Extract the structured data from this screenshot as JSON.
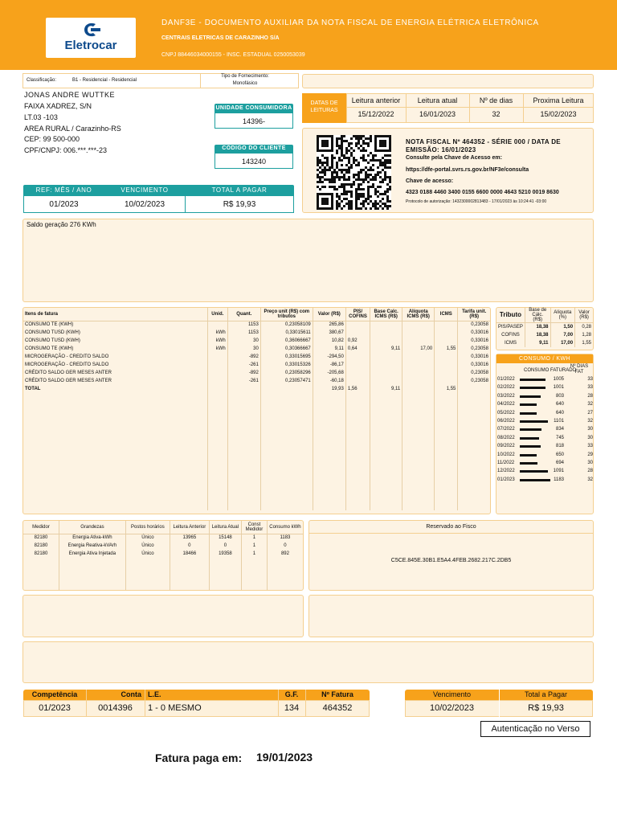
{
  "header": {
    "logo_text": "Eletrocar",
    "title": "DANF3E - DOCUMENTO AUXILIAR DA NOTA FISCAL DE ENERGIA ELÉTRICA ELETRÔNICA",
    "company": "CENTRAIS ELETRICAS DE CARAZINHO S/A",
    "cnpj": "CNPJ 88446034000155 - INSC. ESTADUAL 0250053039"
  },
  "classification": {
    "label": "Classificação:",
    "value": "B1 - Residencial - Residencial",
    "supply_label": "Tipo de Fornecimento:",
    "supply_value": "Monofásico"
  },
  "customer": {
    "name": "JONAS ANDRE WUTTKE",
    "address1": "FAIXA XADREZ, S/N",
    "address2": "LT.03 -103",
    "address3": "AREA RURAL / Carazinho-RS",
    "cep": "CEP: 99 500-000",
    "cpf": "CPF/CNPJ: 006.***.***-23"
  },
  "unit": {
    "label": "UNIDADE CONSUMIDORA",
    "value": "14396-"
  },
  "client_code": {
    "label": "CÓDIGO DO CLIENTE",
    "value": "143240"
  },
  "ref_box": {
    "ref_label": "REF: MÊS / ANO",
    "ref_value": "01/2023",
    "due_label": "VENCIMENTO",
    "due_value": "10/02/2023",
    "total_label": "TOTAL A PAGAR",
    "total_value": "R$ 19,93"
  },
  "readings": {
    "label_line1": "DATAS DE",
    "label_line2": "LEITURAS",
    "columns": [
      {
        "label": "Leitura anterior",
        "value": "15/12/2022"
      },
      {
        "label": "Leitura atual",
        "value": "16/01/2023"
      },
      {
        "label": "Nº de dias",
        "value": "32"
      },
      {
        "label": "Proxima Leitura",
        "value": "15/02/2023"
      }
    ]
  },
  "nf": {
    "line1": "NOTA FISCAL Nº 464352 - SÉRIE 000 / DATA DE",
    "line2": "EMISSÃO: 16/01/2023",
    "line3": "Consulte pela Chave de Acesso em:",
    "url": "https://dfe-portal.svrs.rs.gov.br/NF3e/consulta",
    "key_label": "Chave de acesso:",
    "key": "4323 0188 4460 3400 0155 6600 0000 4643 5210 0019 8630",
    "protocol": "Protocolo de autorização: 1432300002813483 - 17/01/2023 às 10:24:41 -03:00"
  },
  "messages": {
    "text": "Saldo geração 276 KWh"
  },
  "items": {
    "headers": [
      "Itens de fatura",
      "Unid.",
      "Quant.",
      "Preço unit (R$) com tributos",
      "Valor (R$)",
      "PIS/ COFINS",
      "Base Calc. ICMS (R$)",
      "Alíquota ICMS (R$)",
      "ICMS",
      "Tarifa unit. (R$)"
    ],
    "rows": [
      [
        "CONSUMO TE (KWH)",
        "",
        "1153",
        "0,23058109",
        "265,86",
        "",
        "",
        "",
        "",
        "0,23058"
      ],
      [
        "CONSUMO TUSD (KWH)",
        "kWh",
        "1153",
        "0,33015611",
        "380,67",
        "",
        "",
        "",
        "",
        "0,33016"
      ],
      [
        "CONSUMO TUSD (KWH)",
        "kWh",
        "30",
        "0,36066667",
        "10,82",
        "0,92",
        "",
        "",
        "",
        "0,33016"
      ],
      [
        "CONSUMO TE (KWH)",
        "kWh",
        "30",
        "0,30366667",
        "9,11",
        "0,64",
        "9,11",
        "17,00",
        "1,55",
        "0,23058"
      ],
      [
        "MICROGERAÇÃO - CREDITO SALDO",
        "",
        "-892",
        "0,33015695",
        "-294,50",
        "",
        "",
        "",
        "",
        "0,33016"
      ],
      [
        "MICROGERAÇÃO - CREDITO SALDO",
        "",
        "-261",
        "0,33015326",
        "-86,17",
        "",
        "",
        "",
        "",
        "0,33016"
      ],
      [
        "CRÉDITO SALDO GER MESES ANTER",
        "",
        "-892",
        "0,23058296",
        "-205,68",
        "",
        "",
        "",
        "",
        "0,23058"
      ],
      [
        "CRÉDITO SALDO GER MESES ANTER",
        "",
        "-261",
        "0,23057471",
        "-60,18",
        "",
        "",
        "",
        "",
        "0,23058"
      ]
    ],
    "total": [
      "TOTAL",
      "",
      "",
      "",
      "19,93",
      "1,56",
      "9,11",
      "",
      "1,55",
      ""
    ]
  },
  "taxes": {
    "headers": [
      "Tributo",
      "Base de Cálc. (R$)",
      "Alíquota (%)",
      "Valor (R$)"
    ],
    "rows": [
      [
        "PIS/PASEP",
        "18,38",
        "1,50",
        "0,28"
      ],
      [
        "COFINS",
        "18,38",
        "7,00",
        "1,28"
      ],
      [
        "ICMS",
        "9,11",
        "17,00",
        "1,55"
      ]
    ]
  },
  "consumption": {
    "title": "CONSUMO / KWH",
    "col1": "CONSUMO FATURADO",
    "col2": "Nº DIAS FAT",
    "max": 1183,
    "rows": [
      {
        "month": "01/2022",
        "kwh": 1005,
        "days": "33"
      },
      {
        "month": "02/2022",
        "kwh": 1001,
        "days": "33"
      },
      {
        "month": "03/2022",
        "kwh": 803,
        "days": "28"
      },
      {
        "month": "04/2022",
        "kwh": 640,
        "days": "32"
      },
      {
        "month": "05/2022",
        "kwh": 640,
        "days": "27"
      },
      {
        "month": "06/2022",
        "kwh": 1101,
        "days": "32"
      },
      {
        "month": "07/2022",
        "kwh": 834,
        "days": "30"
      },
      {
        "month": "08/2022",
        "kwh": 745,
        "days": "30"
      },
      {
        "month": "09/2022",
        "kwh": 818,
        "days": "33"
      },
      {
        "month": "10/2022",
        "kwh": 650,
        "days": "29"
      },
      {
        "month": "11/2022",
        "kwh": 694,
        "days": "30"
      },
      {
        "month": "12/2022",
        "kwh": 1091,
        "days": "28"
      },
      {
        "month": "01/2023",
        "kwh": 1183,
        "days": "32"
      }
    ]
  },
  "meters": {
    "headers": [
      "Medidor",
      "Grandezas",
      "Postos horários",
      "Leitura Anterior",
      "Leitura Atual",
      "Const Medidor",
      "Consumo kWh"
    ],
    "rows": [
      [
        "82180",
        "Energia Ativa-kWh",
        "Único",
        "13965",
        "15148",
        "1",
        "1183"
      ],
      [
        "82180",
        "Energia Reativa-kVArh",
        "Único",
        "0",
        "0",
        "1",
        "0"
      ],
      [
        "82180",
        "Energia Ativa Injetada",
        "Único",
        "18466",
        "19358",
        "1",
        "892"
      ]
    ]
  },
  "fisco": {
    "title": "Reservado ao Fisco",
    "code": "C5CE.845E.30B1.E5A4.4FEB.2682.217C.2DB5"
  },
  "footer": {
    "labels": [
      "Competência",
      "Conta",
      "L.E.",
      "G.F.",
      "Nº Fatura"
    ],
    "values": [
      "01/2023",
      "0014396",
      "1 - 0 MESMO",
      "134",
      "464352"
    ],
    "due_label": "Vencimento",
    "due_value": "10/02/2023",
    "total_label": "Total a Pagar",
    "total_value": "R$ 19,93",
    "auth": "Autenticação no Verso"
  },
  "paid": {
    "label": "Fatura paga em:",
    "date": "19/01/2023"
  }
}
